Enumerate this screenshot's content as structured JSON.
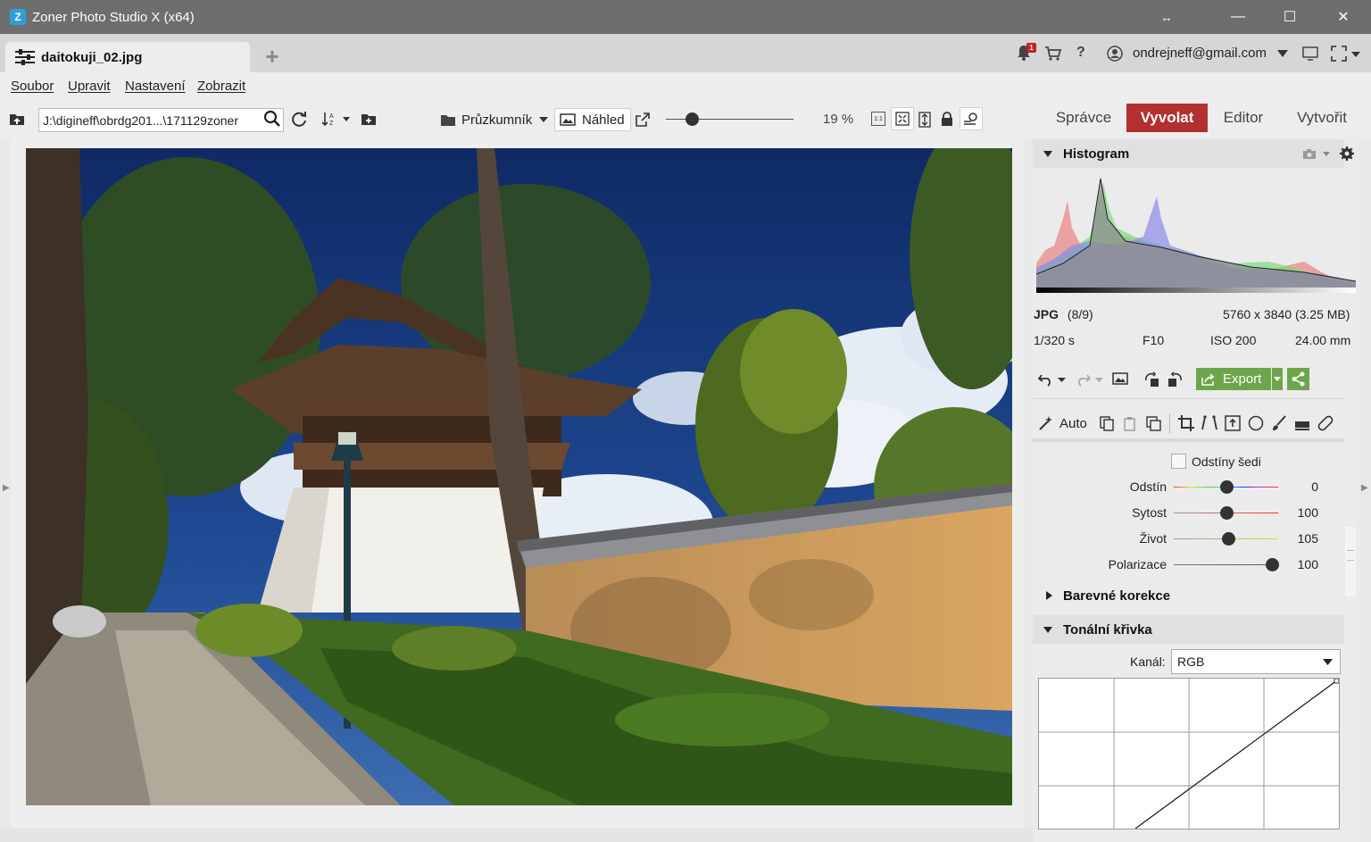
{
  "window": {
    "title": "Zoner Photo Studio X (x64)",
    "logo_letter": "Z",
    "controls": {
      "resize": "↔",
      "minimize": "—",
      "maximize": "☐",
      "close": "✕"
    }
  },
  "tabs": {
    "document": "daitokuji_02.jpg",
    "add": "+"
  },
  "account": {
    "notification_count": "1",
    "email": "ondrejneff@gmail.com",
    "help": "?"
  },
  "menu": {
    "items": [
      "Soubor",
      "Upravit",
      "Nastavení",
      "Zobrazit"
    ]
  },
  "toolbar": {
    "path": "J:\\digineff\\obrdg201...\\171129zoner",
    "explorer_label": "Průzkumník",
    "preview_label": "Náhled",
    "zoom_value": "19 %",
    "zoom_fraction": 0.2,
    "actual_size": "1:1"
  },
  "modes": {
    "items": [
      "Správce",
      "Vyvolat",
      "Editor",
      "Vytvořit"
    ],
    "active": "Vyvolat",
    "active_color": "#b2302f"
  },
  "histogram": {
    "title": "Histogram"
  },
  "file_info": {
    "format": "JPG",
    "position": "(8/9)",
    "dimensions": "5760 x 3840 (3.25 MB)",
    "shutter": "1/320 s",
    "aperture": "F10",
    "iso": "ISO 200",
    "focal": "24.00 mm"
  },
  "actions": {
    "export_label": "Export",
    "accent_color": "#6da54a"
  },
  "tools": {
    "auto_label": "Auto"
  },
  "color_panel": {
    "grayscale_label": "Odstíny šedi",
    "sliders": [
      {
        "label": "Odstín",
        "value": "0",
        "fraction": 0.5
      },
      {
        "label": "Sytost",
        "value": "100",
        "fraction": 0.5
      },
      {
        "label": "Život",
        "value": "105",
        "fraction": 0.52
      },
      {
        "label": "Polarizace",
        "value": "100",
        "fraction": 0.94
      }
    ]
  },
  "sections": {
    "color_corrections": "Barevné korekce",
    "tone_curve": "Tonální křivka"
  },
  "tone_curve": {
    "channel_label": "Kanál:",
    "channel_value": "RGB"
  }
}
